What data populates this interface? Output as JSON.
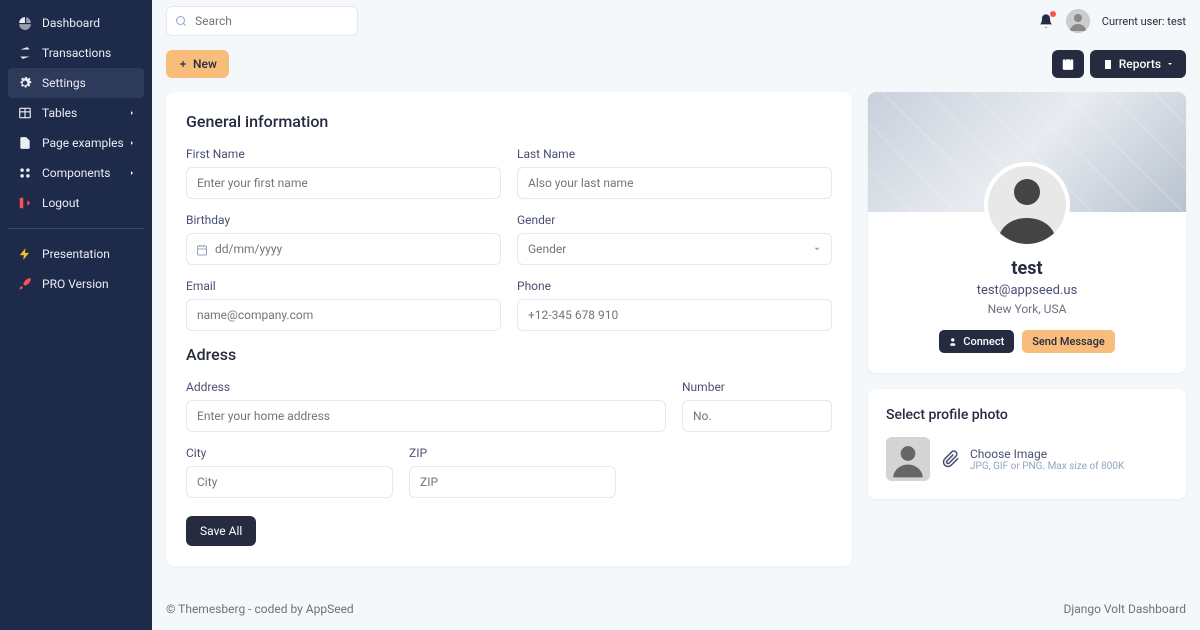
{
  "sidebar": {
    "items": [
      {
        "label": "Dashboard"
      },
      {
        "label": "Transactions"
      },
      {
        "label": "Settings"
      },
      {
        "label": "Tables"
      },
      {
        "label": "Page examples"
      },
      {
        "label": "Components"
      },
      {
        "label": "Logout"
      }
    ],
    "extra": [
      {
        "label": "Presentation"
      },
      {
        "label": "PRO Version"
      }
    ]
  },
  "topbar": {
    "search_placeholder": "Search",
    "user_label": "Current user: test"
  },
  "toolbar": {
    "new_label": "New",
    "reports_label": "Reports"
  },
  "form": {
    "section1_title": "General information",
    "first_name_label": "First Name",
    "first_name_ph": "Enter your first name",
    "last_name_label": "Last Name",
    "last_name_ph": "Also your last name",
    "birthday_label": "Birthday",
    "birthday_ph": "dd/mm/yyyy",
    "gender_label": "Gender",
    "gender_ph": "Gender",
    "email_label": "Email",
    "email_ph": "name@company.com",
    "phone_label": "Phone",
    "phone_ph": "+12-345 678 910",
    "section2_title": "Adress",
    "address_label": "Address",
    "address_ph": "Enter your home address",
    "number_label": "Number",
    "number_ph": "No.",
    "city_label": "City",
    "city_ph": "City",
    "zip_label": "ZIP",
    "zip_ph": "ZIP",
    "save_label": "Save All"
  },
  "profile": {
    "name": "test",
    "email": "test@appseed.us",
    "location": "New York, USA",
    "connect_label": "Connect",
    "message_label": "Send Message"
  },
  "upload": {
    "title": "Select profile photo",
    "choose_label": "Choose Image",
    "hint": "JPG, GIF or PNG. Max size of 800K"
  },
  "footer": {
    "left": "© Themesberg - coded by AppSeed",
    "right": "Django Volt Dashboard"
  }
}
